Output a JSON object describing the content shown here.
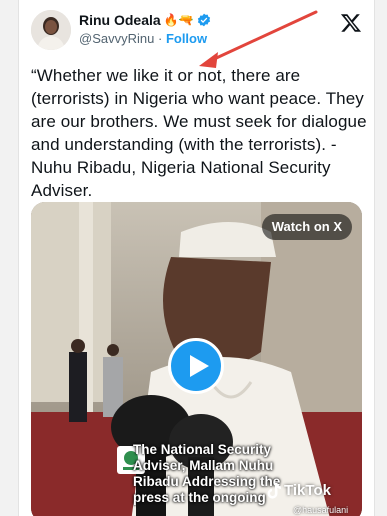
{
  "tweet": {
    "author_name": "Rinu Odeala",
    "author_emojis": "🔥🔫",
    "handle": "@SavvyRinu",
    "separator": "·",
    "follow_label": "Follow",
    "text": "“Whether we like it or not, there are (terrorists) in Nigeria who want peace. They are our brothers. We must seek for dialogue and understanding (with the terrorists). - Nuhu Ribadu, Nigeria National Security Adviser."
  },
  "media": {
    "watch_label": "Watch on X",
    "caption_lines": [
      "The National Security",
      "Adviser, Mallam Nuhu",
      "Ribadu Addressing the",
      "press at the ongoing"
    ],
    "tiktok_label": "TikTok",
    "tiktok_handle": "@hausafulani"
  },
  "colors": {
    "accent": "#1d9bf0",
    "annotation_arrow": "#e2453c",
    "text": "#0f1419",
    "secondary_text": "#536471"
  },
  "icons": [
    "verified-badge-icon",
    "x-logo-icon",
    "play-icon",
    "tiktok-logo-icon",
    "annotation-arrow"
  ]
}
